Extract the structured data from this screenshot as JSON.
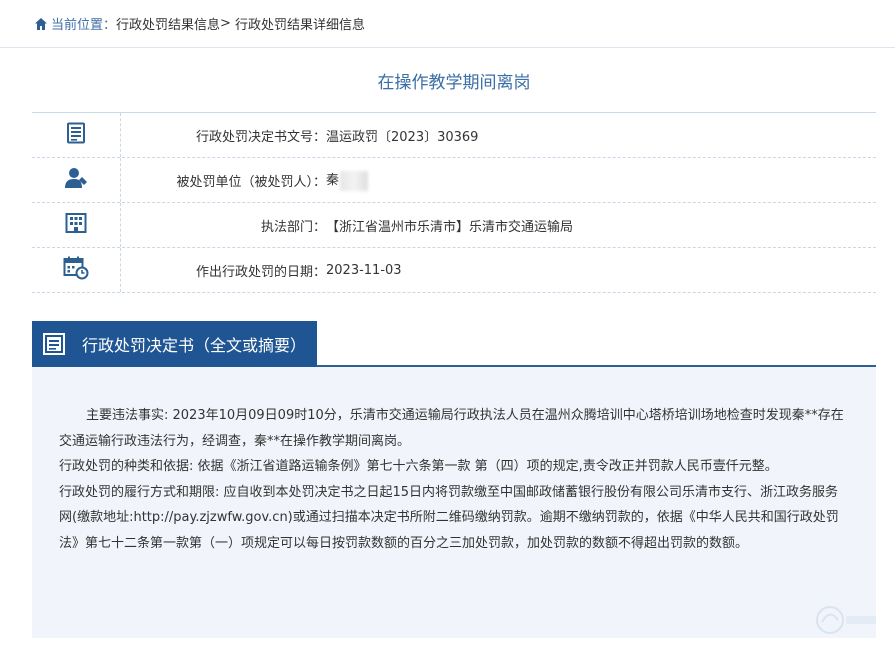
{
  "breadcrumb": {
    "prefix": "当前位置：",
    "link1": "行政处罚结果信息",
    "sep": ">",
    "link2": "行政处罚结果详细信息"
  },
  "title": "在操作教学期间离岗",
  "info": {
    "rows": [
      {
        "icon": "document-list-icon",
        "label": "行政处罚决定书文号：",
        "value": "温运政罚〔2023〕30369"
      },
      {
        "icon": "person-icon",
        "label": "被处罚单位（被处罚人）：",
        "value": "秦"
      },
      {
        "icon": "building-icon",
        "label": "执法部门：",
        "value": "【浙江省温州市乐清市】乐清市交通运输局"
      },
      {
        "icon": "calendar-icon",
        "label": "作出行政处罚的日期：",
        "value": "2023-11-03"
      }
    ]
  },
  "section": {
    "title": "行政处罚决定书（全文或摘要）"
  },
  "content": {
    "p1": "主要违法事实: 2023年10月09日09时10分，乐清市交通运输局行政执法人员在温州众腾培训中心塔桥培训场地检查时发现秦**存在交通运输行政违法行为，经调查，秦**在操作教学期间离岗。",
    "p2": "行政处罚的种类和依据: 依据《浙江省道路运输条例》第七十六条第一款 第（四）项的规定,责令改正并罚款人民币壹仟元整。",
    "p3": "行政处罚的履行方式和期限: 应自收到本处罚决定书之日起15日内将罚款缴至中国邮政储蓄银行股份有限公司乐清市支行、浙江政务服务网(缴款地址:http://pay.zjzwfw.gov.cn)或通过扫描本决定书所附二维码缴纳罚款。逾期不缴纳罚款的，依据《中华人民共和国行政处罚法》第七十二条第一款第（一）项规定可以每日按罚款数额的百分之三加处罚款，加处罚款的数额不得超出罚款的数额。"
  },
  "colors": {
    "accent": "#1f5592",
    "link": "#3b6ea5",
    "content_bg": "#f1f5fb"
  }
}
